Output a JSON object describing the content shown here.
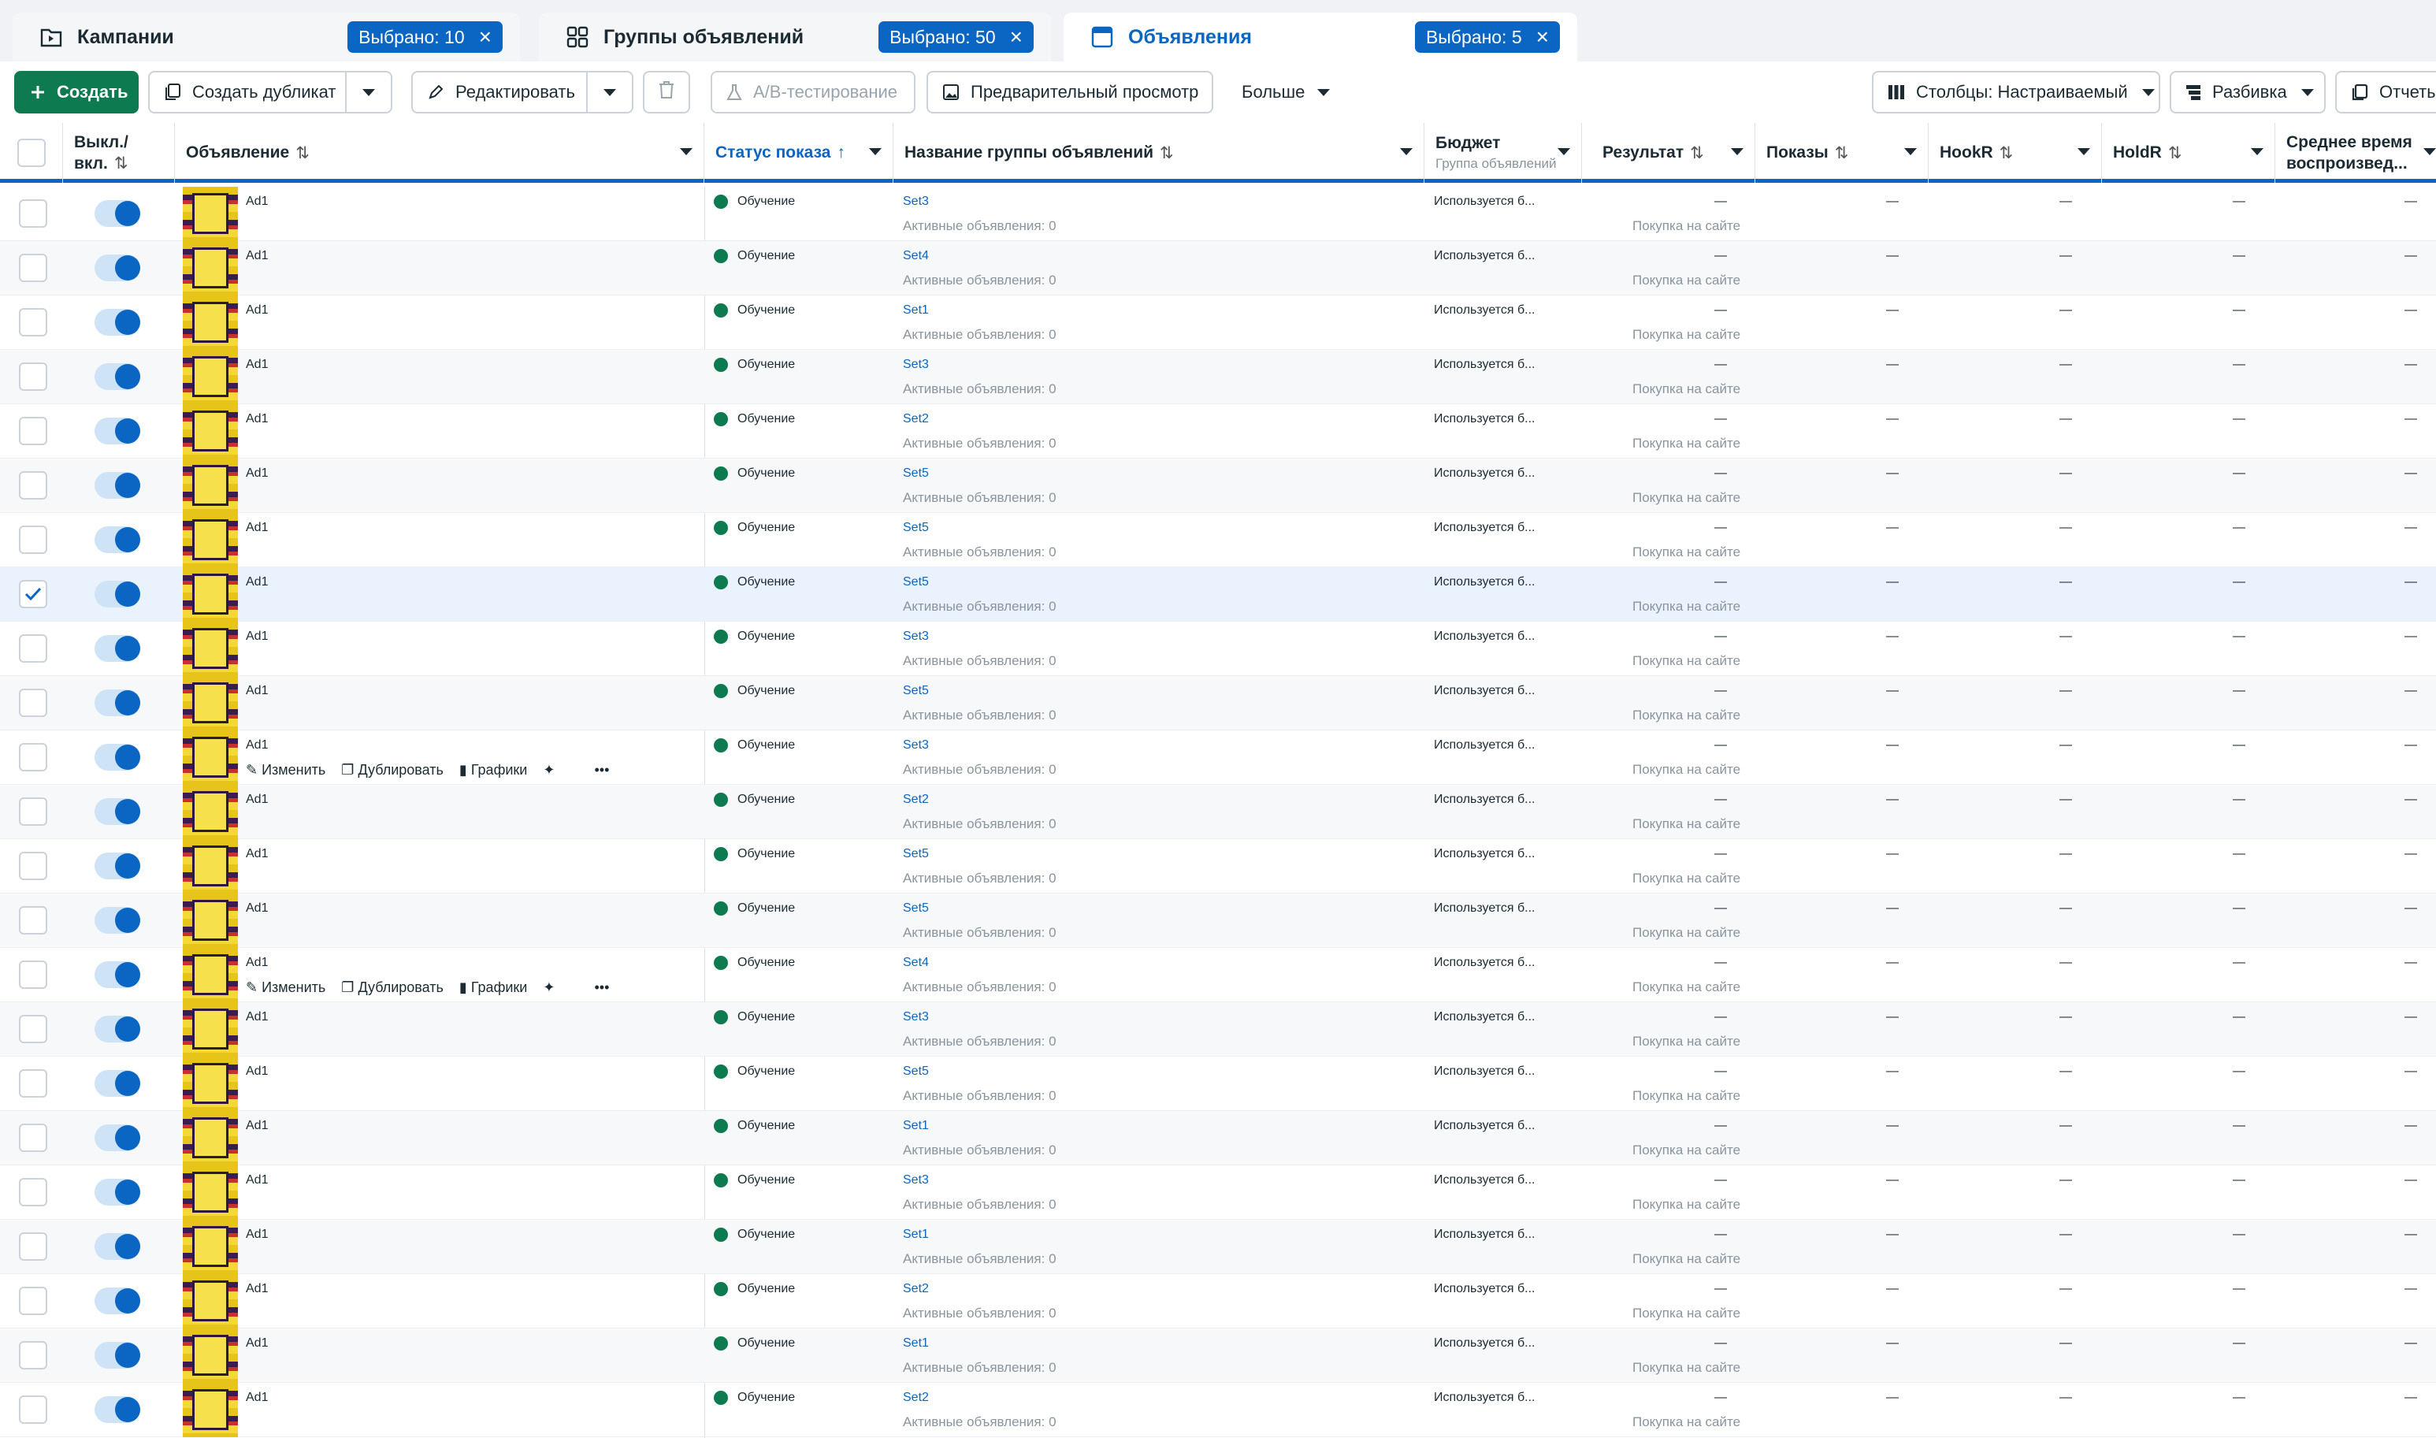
{
  "tabs": [
    {
      "label": "Кампании",
      "badge": "Выбрано: 10",
      "icon": "folder-icon"
    },
    {
      "label": "Группы объявлений",
      "badge": "Выбрано: 50",
      "icon": "grid-icon"
    },
    {
      "label": "Объявления",
      "badge": "Выбрано: 5",
      "icon": "ad-card-icon"
    }
  ],
  "toolbar": {
    "create": "Создать",
    "duplicate": "Создать дубликат",
    "edit": "Редактировать",
    "ab_test": "A/B-тестирование",
    "preview": "Предварительный просмотр",
    "more": "Больше",
    "columns": "Столбцы: Настраиваемый",
    "breakdown": "Разбивка",
    "reports": "Отчеты"
  },
  "columns": {
    "onoff_line1": "Выкл./",
    "onoff_line2": "вкл.",
    "ad": "Объявление",
    "status": "Статус показа",
    "adset": "Название группы объявлений",
    "budget": "Бюджет",
    "budget_sub": "Группа объявлений",
    "result": "Результат",
    "impressions": "Показы",
    "hookr": "HookR",
    "holdr": "HoldR",
    "avg_line1": "Среднее время",
    "avg_line2": "воспроизвед..."
  },
  "row_text": {
    "status": "Обучение",
    "adset_sub": "Активные объявления: 0",
    "budget": "Используется б...",
    "dash": "—",
    "result_sub": "Покупка на сайте"
  },
  "hover_actions": {
    "edit": "Изменить",
    "duplicate": "Дублировать",
    "charts": "Графики"
  },
  "rows": [
    {
      "ad": "Ad1",
      "set": "Set3",
      "checked": false,
      "hover": false
    },
    {
      "ad": "Ad1",
      "set": "Set4",
      "checked": false,
      "hover": false
    },
    {
      "ad": "Ad1",
      "set": "Set1",
      "checked": false,
      "hover": false
    },
    {
      "ad": "Ad1",
      "set": "Set3",
      "checked": false,
      "hover": false
    },
    {
      "ad": "Ad1",
      "set": "Set2",
      "checked": false,
      "hover": false
    },
    {
      "ad": "Ad1",
      "set": "Set5",
      "checked": false,
      "hover": false
    },
    {
      "ad": "Ad1",
      "set": "Set5",
      "checked": false,
      "hover": false
    },
    {
      "ad": "Ad1",
      "set": "Set5",
      "checked": true,
      "hover": false
    },
    {
      "ad": "Ad1",
      "set": "Set3",
      "checked": false,
      "hover": false
    },
    {
      "ad": "Ad1",
      "set": "Set5",
      "checked": false,
      "hover": false
    },
    {
      "ad": "Ad1",
      "set": "Set3",
      "checked": false,
      "hover": true
    },
    {
      "ad": "Ad1",
      "set": "Set2",
      "checked": false,
      "hover": false
    },
    {
      "ad": "Ad1",
      "set": "Set5",
      "checked": false,
      "hover": false
    },
    {
      "ad": "Ad1",
      "set": "Set5",
      "checked": false,
      "hover": false
    },
    {
      "ad": "Ad1",
      "set": "Set4",
      "checked": false,
      "hover": true
    },
    {
      "ad": "Ad1",
      "set": "Set3",
      "checked": false,
      "hover": false
    },
    {
      "ad": "Ad1",
      "set": "Set5",
      "checked": false,
      "hover": false
    },
    {
      "ad": "Ad1",
      "set": "Set1",
      "checked": false,
      "hover": false
    },
    {
      "ad": "Ad1",
      "set": "Set3",
      "checked": false,
      "hover": false
    },
    {
      "ad": "Ad1",
      "set": "Set1",
      "checked": false,
      "hover": false
    },
    {
      "ad": "Ad1",
      "set": "Set2",
      "checked": false,
      "hover": false
    },
    {
      "ad": "Ad1",
      "set": "Set1",
      "checked": false,
      "hover": false
    },
    {
      "ad": "Ad1",
      "set": "Set2",
      "checked": false,
      "hover": false
    }
  ],
  "colors": {
    "accent": "#0a66c2",
    "create": "#0d7a4f",
    "status_dot": "#0d7a4f"
  }
}
